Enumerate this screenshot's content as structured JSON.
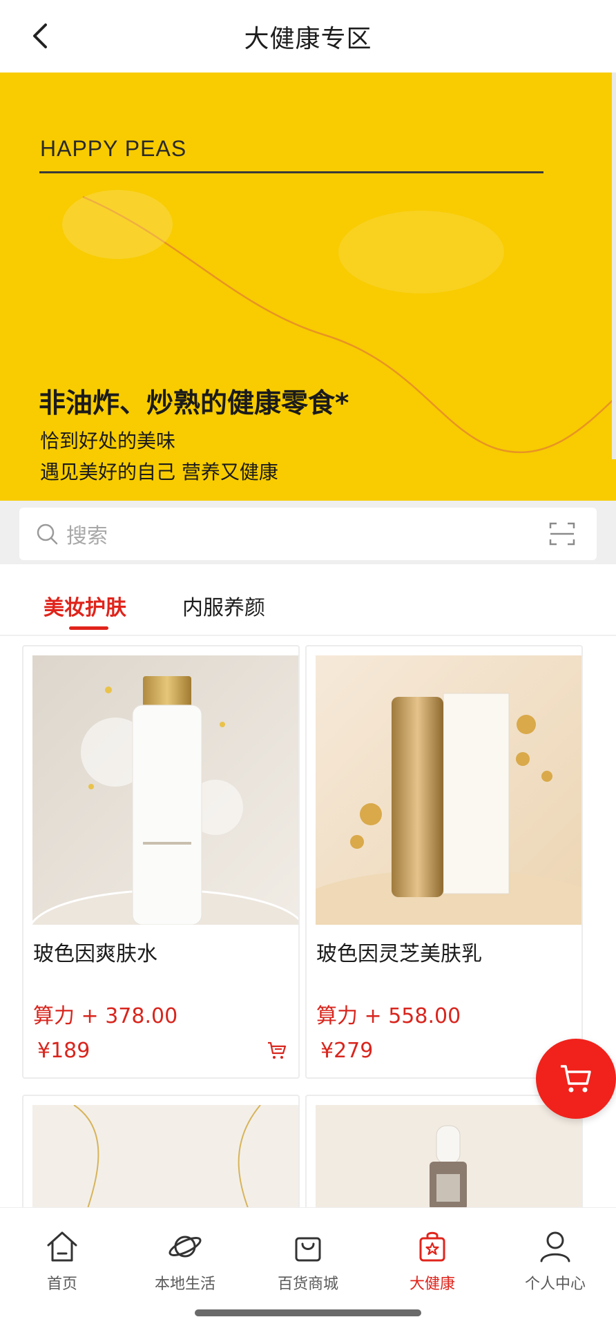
{
  "header": {
    "title": "大健康专区",
    "back_icon": "chevron-left-icon"
  },
  "banner": {
    "brand": "HAPPY PEAS",
    "headline": "非油炸、炒熟的健康零食*",
    "line1": "恰到好处的美味",
    "line2": "遇见美好的自己 营养又健康",
    "background": "#f8cc00"
  },
  "search": {
    "placeholder": "搜索",
    "search_icon": "search-icon",
    "scan_icon": "scan-icon"
  },
  "tabs": [
    {
      "label": "美妆护肤",
      "active": true
    },
    {
      "label": "内服养颜",
      "active": false
    }
  ],
  "products": [
    {
      "name": "玻色因爽肤水",
      "power": "算力 + 378.00",
      "price": "¥189"
    },
    {
      "name": "玻色因灵芝美肤乳",
      "power": "算力 + 558.00",
      "price": "¥279"
    }
  ],
  "bottom_nav": [
    {
      "label": "首页",
      "icon": "home-icon",
      "active": false
    },
    {
      "label": "本地生活",
      "icon": "planet-icon",
      "active": false
    },
    {
      "label": "百货商城",
      "icon": "shopping-bag-icon",
      "active": false
    },
    {
      "label": "大健康",
      "icon": "health-bag-icon",
      "active": true
    },
    {
      "label": "个人中心",
      "icon": "user-icon",
      "active": false
    }
  ],
  "colors": {
    "accent": "#e0241b",
    "banner": "#f8cc00",
    "fab": "#f0221b"
  },
  "fab": {
    "icon": "shopping-cart-icon"
  }
}
